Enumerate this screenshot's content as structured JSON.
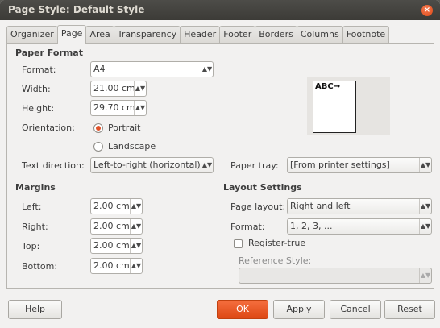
{
  "window": {
    "title": "Page Style: Default Style",
    "close_glyph": "×"
  },
  "tabs": [
    {
      "label": "Organizer"
    },
    {
      "label": "Page"
    },
    {
      "label": "Area"
    },
    {
      "label": "Transparency"
    },
    {
      "label": "Header"
    },
    {
      "label": "Footer"
    },
    {
      "label": "Borders"
    },
    {
      "label": "Columns"
    },
    {
      "label": "Footnote"
    }
  ],
  "active_tab": "Page",
  "paper_format": {
    "title": "Paper Format",
    "format_label": "Format:",
    "format_value": "A4",
    "width_label": "Width:",
    "width_value": "21.00 cm",
    "height_label": "Height:",
    "height_value": "29.70 cm",
    "orientation_label": "Orientation:",
    "portrait_label": "Portrait",
    "landscape_label": "Landscape",
    "orientation_selected": "Portrait",
    "text_direction_label": "Text direction:",
    "text_direction_value": "Left-to-right (horizontal)",
    "paper_tray_label": "Paper tray:",
    "paper_tray_value": "[From printer settings]",
    "preview_text": "ABC→"
  },
  "margins": {
    "title": "Margins",
    "left_label": "Left:",
    "left_value": "2.00 cm",
    "right_label": "Right:",
    "right_value": "2.00 cm",
    "top_label": "Top:",
    "top_value": "2.00 cm",
    "bottom_label": "Bottom:",
    "bottom_value": "2.00 cm"
  },
  "layout_settings": {
    "title": "Layout Settings",
    "page_layout_label": "Page layout:",
    "page_layout_value": "Right and left",
    "format_label": "Format:",
    "format_value": "1, 2, 3, ...",
    "register_true_label": "Register-true",
    "register_true_checked": false,
    "reference_style_label": "Reference Style:",
    "reference_style_value": ""
  },
  "buttons": {
    "help": "Help",
    "ok": "OK",
    "apply": "Apply",
    "cancel": "Cancel",
    "reset": "Reset"
  },
  "colors": {
    "accent": "#dd4814",
    "titlebar": "#3c3b37",
    "dialog_bg": "#f2f1f0"
  }
}
